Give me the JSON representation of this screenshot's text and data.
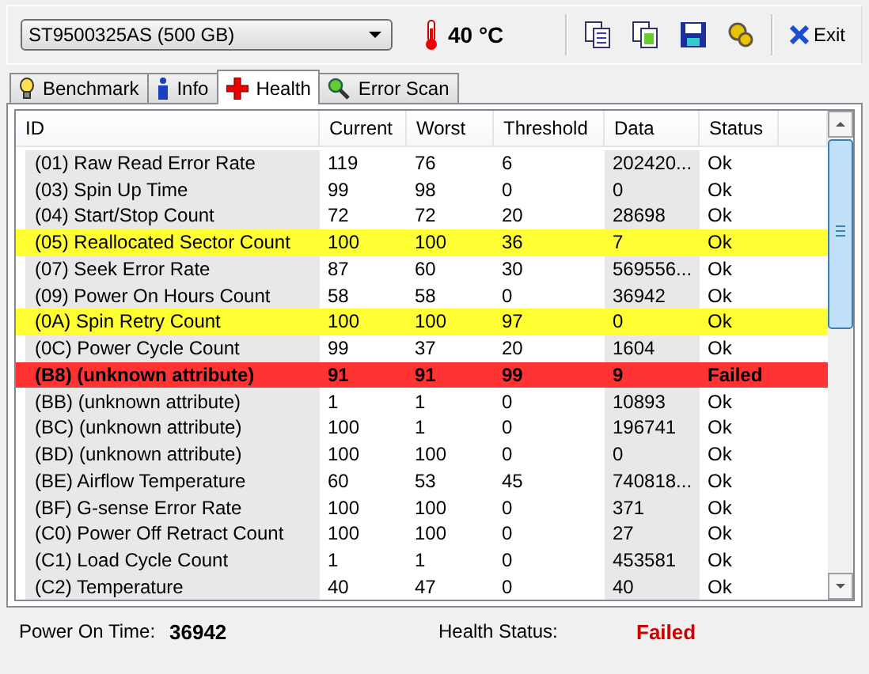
{
  "toolbar": {
    "drive": "ST9500325AS (500 GB)",
    "temperature": "40 °C",
    "exit": "Exit"
  },
  "tabs": [
    {
      "label": "Benchmark",
      "selected": false
    },
    {
      "label": "Info",
      "selected": false
    },
    {
      "label": "Health",
      "selected": true
    },
    {
      "label": "Error Scan",
      "selected": false
    }
  ],
  "table": {
    "columns": [
      "ID",
      "Current",
      "Worst",
      "Threshold",
      "Data",
      "Status"
    ],
    "rows": [
      {
        "kind": "normal",
        "cells": [
          "(01) Raw Read Error Rate",
          "119",
          "76",
          "6",
          "202420...",
          "Ok"
        ]
      },
      {
        "kind": "normal",
        "cells": [
          "(03) Spin Up Time",
          "99",
          "98",
          "0",
          "0",
          "Ok"
        ]
      },
      {
        "kind": "normal",
        "cells": [
          "(04) Start/Stop Count",
          "72",
          "72",
          "20",
          "28698",
          "Ok"
        ]
      },
      {
        "kind": "warning",
        "cells": [
          "(05) Reallocated Sector Count",
          "100",
          "100",
          "36",
          "7",
          "Ok"
        ]
      },
      {
        "kind": "normal",
        "cells": [
          "(07) Seek Error Rate",
          "87",
          "60",
          "30",
          "569556...",
          "Ok"
        ]
      },
      {
        "kind": "normal",
        "cells": [
          "(09) Power On Hours Count",
          "58",
          "58",
          "0",
          "36942",
          "Ok"
        ]
      },
      {
        "kind": "warning",
        "cells": [
          "(0A) Spin Retry Count",
          "100",
          "100",
          "97",
          "0",
          "Ok"
        ]
      },
      {
        "kind": "normal",
        "cells": [
          "(0C) Power Cycle Count",
          "99",
          "37",
          "20",
          "1604",
          "Ok"
        ]
      },
      {
        "kind": "failed",
        "cells": [
          "(B8) (unknown attribute)",
          "91",
          "91",
          "99",
          "9",
          "Failed"
        ]
      },
      {
        "kind": "normal",
        "cells": [
          "(BB) (unknown attribute)",
          "1",
          "1",
          "0",
          "10893",
          "Ok"
        ]
      },
      {
        "kind": "normal",
        "cells": [
          "(BC) (unknown attribute)",
          "100",
          "1",
          "0",
          "196741",
          "Ok"
        ]
      },
      {
        "kind": "normal",
        "cells": [
          "(BD) (unknown attribute)",
          "100",
          "100",
          "0",
          "0",
          "Ok"
        ]
      },
      {
        "kind": "normal",
        "cells": [
          "(BE) Airflow Temperature",
          "60",
          "53",
          "45",
          "740818...",
          "Ok"
        ]
      },
      {
        "kind": "normal",
        "cells": [
          "(BF) G-sense Error Rate",
          "100",
          "100",
          "0",
          "371",
          "Ok"
        ]
      },
      {
        "kind": "normal",
        "cells": [
          "(C0) Power Off Retract Count",
          "100",
          "100",
          "0",
          "27",
          "Ok"
        ]
      },
      {
        "kind": "normal",
        "cells": [
          "(C1) Load Cycle Count",
          "1",
          "1",
          "0",
          "453581",
          "Ok"
        ]
      },
      {
        "kind": "normal",
        "cells": [
          "(C2) Temperature",
          "40",
          "47",
          "0",
          "40",
          "Ok"
        ]
      }
    ]
  },
  "footer": {
    "power_on_label": "Power On Time:",
    "power_on_value": "36942",
    "health_label": "Health Status:",
    "health_value": "Failed"
  }
}
